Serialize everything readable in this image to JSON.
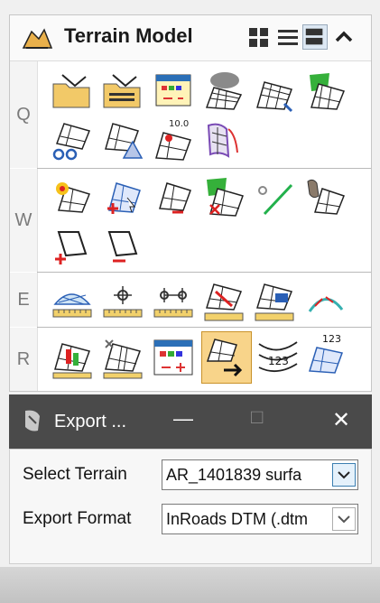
{
  "toolbox": {
    "title": "Terrain Model",
    "rows": [
      {
        "label": "Q"
      },
      {
        "label": "W"
      },
      {
        "label": "E"
      },
      {
        "label": "R"
      }
    ]
  },
  "dialog": {
    "title": "Export ...",
    "minimize_glyph": "—",
    "maximize_glyph": "□",
    "close_glyph": "✕",
    "fields": [
      {
        "label": "Select Terrain",
        "value": "AR_1401839 surfa"
      },
      {
        "label": "Export Format",
        "value": "InRoads DTM (.dtm"
      }
    ]
  },
  "colors": {
    "accent": "#3c7fb1",
    "highlight": "#f8d48a",
    "titlebar": "#4a4a4a"
  }
}
